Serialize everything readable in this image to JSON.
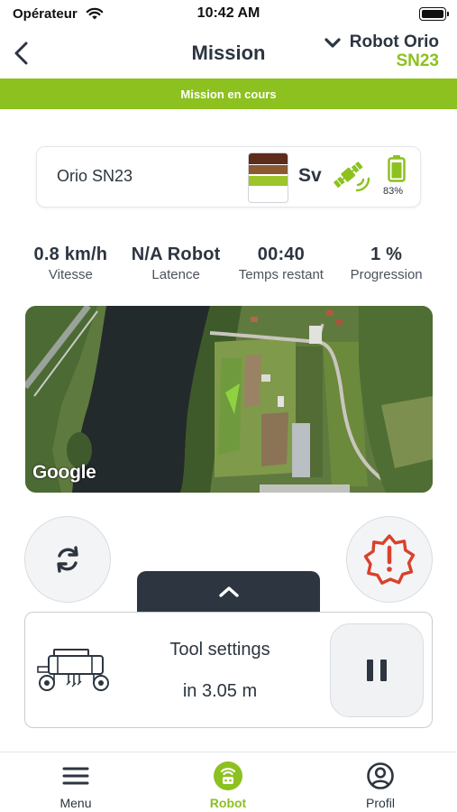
{
  "status_bar": {
    "carrier": "Opérateur",
    "time": "10:42 AM"
  },
  "nav": {
    "title": "Mission",
    "robot_name": "Robot Orio",
    "robot_id": "SN23"
  },
  "banner": {
    "text": "Mission en cours",
    "color": "#8cc11f"
  },
  "robot_card": {
    "name": "Orio SN23",
    "soil_label": "Sv",
    "battery_percent": "83%"
  },
  "stats": [
    {
      "value": "0.8 km/h",
      "label": "Vitesse"
    },
    {
      "value": "N/A Robot",
      "label": "Latence"
    },
    {
      "value": "00:40",
      "label": "Temps restant"
    },
    {
      "value": "1 %",
      "label": "Progression"
    }
  ],
  "map": {
    "attribution": "Google"
  },
  "actions": {
    "sync_icon": "sync-icon",
    "alert_icon": "emergency-alert-icon",
    "expand_icon": "chevron-up-icon"
  },
  "tool_panel": {
    "title": "Tool settings",
    "distance": "in 3.05 m",
    "pause_icon": "pause-icon"
  },
  "tab_bar": {
    "items": [
      {
        "label": "Menu",
        "icon": "menu-icon"
      },
      {
        "label": "Robot",
        "icon": "robot-icon",
        "active": true
      },
      {
        "label": "Profil",
        "icon": "profile-icon"
      }
    ]
  },
  "colors": {
    "accent": "#8cc11f",
    "dark": "#2c3540",
    "alert": "#d9412b"
  }
}
